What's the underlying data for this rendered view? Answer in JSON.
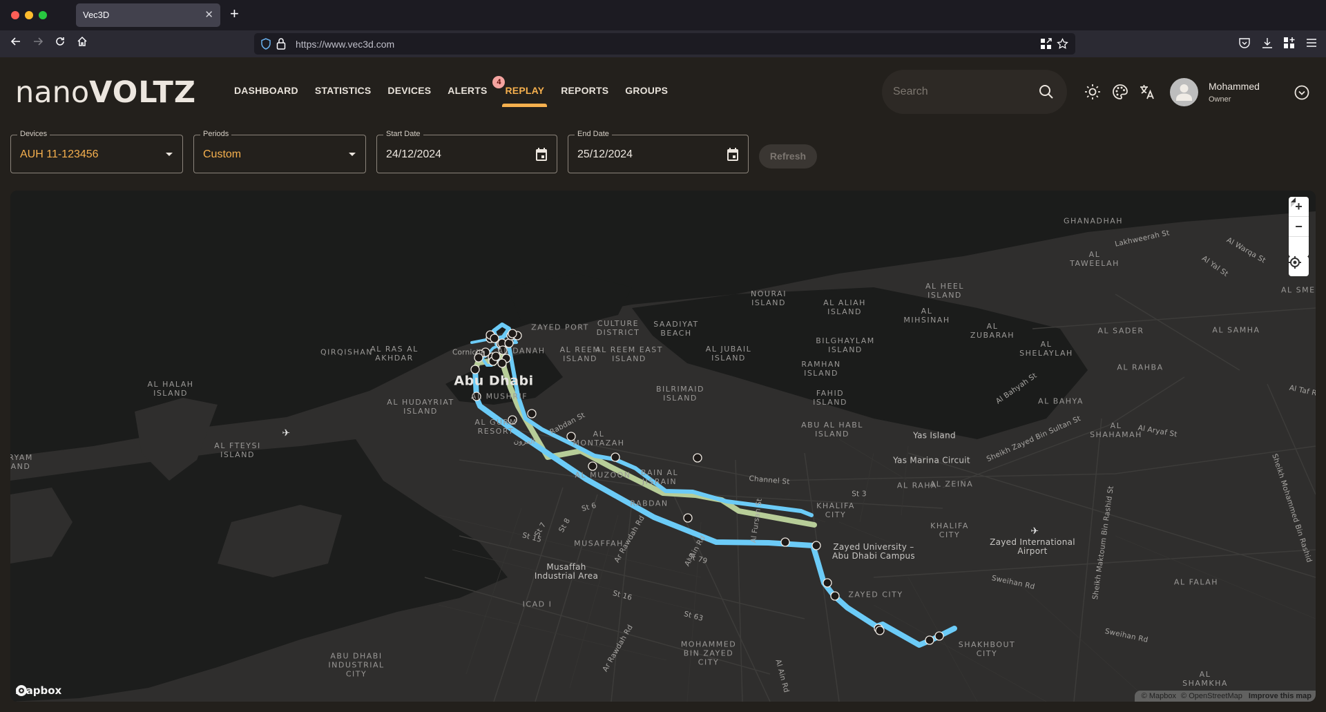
{
  "browser": {
    "tab_title": "Vec3D",
    "url": "https://www.vec3d.com"
  },
  "app": {
    "logo_prefix": "nano",
    "logo_suffix": "VOLTZ",
    "nav": [
      {
        "label": "DASHBOARD",
        "active": false
      },
      {
        "label": "STATISTICS",
        "active": false
      },
      {
        "label": "DEVICES",
        "active": false
      },
      {
        "label": "ALERTS",
        "active": false,
        "badge": "4"
      },
      {
        "label": "REPLAY",
        "active": true
      },
      {
        "label": "REPORTS",
        "active": false
      },
      {
        "label": "GROUPS",
        "active": false
      }
    ],
    "search_placeholder": "Search",
    "user": {
      "name": "Mohammed",
      "role": "Owner"
    },
    "accent_color": "#f6b04e"
  },
  "filters": {
    "device": {
      "label": "Devices",
      "value": "AUH 11-123456"
    },
    "period": {
      "label": "Periods",
      "value": "Custom"
    },
    "start_date": {
      "label": "Start Date",
      "value": "24/12/2024"
    },
    "end_date": {
      "label": "End Date",
      "value": "25/12/2024"
    },
    "refresh_label": "Refresh"
  },
  "map": {
    "route_color_primary": "#6ccbf7",
    "route_color_secondary": "#b7cd98",
    "attribution": {
      "mapbox": "© Mapbox",
      "osm": "© OpenStreetMap",
      "improve": "Improve this map"
    },
    "logo_text": "mapbox",
    "labels": [
      {
        "text": "Abu Dhabi",
        "kind": "city"
      },
      {
        "text": "ZAYED PORT",
        "kind": "area"
      },
      {
        "text": "CULTURE\nDISTRICT",
        "kind": "area"
      },
      {
        "text": "SAADIYAT\nBEACH",
        "kind": "area"
      },
      {
        "text": "AL RAS AL\nAKHDAR",
        "kind": "area"
      },
      {
        "text": "QIRQISHAN",
        "kind": "area"
      },
      {
        "text": "AL DANAH",
        "kind": "area"
      },
      {
        "text": "Corniche",
        "kind": "road"
      },
      {
        "text": "AL REEM\nISLAND",
        "kind": "area"
      },
      {
        "text": "AL REEM EAST\nISLAND",
        "kind": "area"
      },
      {
        "text": "AL JUBAIL\nISLAND",
        "kind": "area"
      },
      {
        "text": "AL MUSHRIF",
        "kind": "area"
      },
      {
        "text": "AL HUDAYRIAT\nISLAND",
        "kind": "area"
      },
      {
        "text": "AL HALAH\nISLAND",
        "kind": "area"
      },
      {
        "text": "AL FTEYSI\nISLAND",
        "kind": "area"
      },
      {
        "text": "RYAM\nAND",
        "kind": "area"
      },
      {
        "text": "AL GURM\nRESORT",
        "kind": "area"
      },
      {
        "text": "المرون",
        "kind": "road"
      },
      {
        "text": "Rabdan St",
        "kind": "road"
      },
      {
        "text": "AL\nMONTAZAH",
        "kind": "area"
      },
      {
        "text": "BILRIMAID\nISLAND",
        "kind": "area"
      },
      {
        "text": "NOURAI\nISLAND",
        "kind": "area"
      },
      {
        "text": "AL ALIAH\nISLAND",
        "kind": "area"
      },
      {
        "text": "AL HEEL\nISLAND",
        "kind": "area"
      },
      {
        "text": "AL\nMIHSINAH",
        "kind": "area"
      },
      {
        "text": "AL\nZUBARAH",
        "kind": "area"
      },
      {
        "text": "BILGHAYLAM\nISLAND",
        "kind": "area"
      },
      {
        "text": "RAMHAN\nISLAND",
        "kind": "area"
      },
      {
        "text": "FAHID\nISLAND",
        "kind": "area"
      },
      {
        "text": "ABU AL HABL\nISLAND",
        "kind": "area"
      },
      {
        "text": "AL\nSHELAYLAH",
        "kind": "area"
      },
      {
        "text": "GHANADHAH",
        "kind": "area"
      },
      {
        "text": "AL\nTAWEELAH",
        "kind": "area"
      },
      {
        "text": "Lakhweerah St",
        "kind": "road"
      },
      {
        "text": "Al Yal St",
        "kind": "road"
      },
      {
        "text": "Al Warqa St",
        "kind": "road"
      },
      {
        "text": "AL SMEIH",
        "kind": "area"
      },
      {
        "text": "AL SADER",
        "kind": "area"
      },
      {
        "text": "AL SAMHA",
        "kind": "area"
      },
      {
        "text": "AL RAHBA",
        "kind": "area"
      },
      {
        "text": "Al Bahyah St",
        "kind": "road"
      },
      {
        "text": "AL BAHYA",
        "kind": "area"
      },
      {
        "text": "Al Taf Rd",
        "kind": "road"
      },
      {
        "text": "Al Aryaf St",
        "kind": "road"
      },
      {
        "text": "AL\nSHAHAMAH",
        "kind": "area"
      },
      {
        "text": "Yas Island",
        "kind": "poi"
      },
      {
        "text": "Yas Marina Circuit",
        "kind": "poi"
      },
      {
        "text": "Sheikh Zayed Bin Sultan St",
        "kind": "road"
      },
      {
        "text": "AL RAHA",
        "kind": "area"
      },
      {
        "text": "AL ZEINA",
        "kind": "area"
      },
      {
        "text": "AL MUZOON",
        "kind": "area"
      },
      {
        "text": "BAIN AL\nJISRAIN",
        "kind": "area"
      },
      {
        "text": "Channel St",
        "kind": "road"
      },
      {
        "text": "St 3",
        "kind": "road"
      },
      {
        "text": "RABDAN",
        "kind": "area"
      },
      {
        "text": "KHALIFA\nCITY",
        "kind": "area"
      },
      {
        "text": "KHALIFA\nCITY",
        "kind": "area"
      },
      {
        "text": "Al Fursan St",
        "kind": "road"
      },
      {
        "text": "Zayed International\nAirport",
        "kind": "poi"
      },
      {
        "text": "Sheikh Maktoum Bin Rashid St",
        "kind": "road"
      },
      {
        "text": "Sheikh Mohammed Bin Rashid",
        "kind": "road"
      },
      {
        "text": "St 6",
        "kind": "road"
      },
      {
        "text": "St 7",
        "kind": "road"
      },
      {
        "text": "St 8",
        "kind": "road"
      },
      {
        "text": "St 15",
        "kind": "road"
      },
      {
        "text": "MUSAFFAH",
        "kind": "area"
      },
      {
        "text": "Ar Rawdah Rd",
        "kind": "road"
      },
      {
        "text": "Al Ain Rd",
        "kind": "road"
      },
      {
        "text": "St 79",
        "kind": "road"
      },
      {
        "text": "Zayed University –\nAbu Dhabi Campus",
        "kind": "poi"
      },
      {
        "text": "Sweihan Rd",
        "kind": "road"
      },
      {
        "text": "Musaffah\nIndustrial Area",
        "kind": "poi"
      },
      {
        "text": "ZAYED CITY",
        "kind": "area"
      },
      {
        "text": "AL FALAH",
        "kind": "area"
      },
      {
        "text": "ICAD I",
        "kind": "area"
      },
      {
        "text": "St 16",
        "kind": "road"
      },
      {
        "text": "St 63",
        "kind": "road"
      },
      {
        "text": "Ar Rawdah Rd",
        "kind": "road"
      },
      {
        "text": "SHAKHBOUT\nCITY",
        "kind": "area"
      },
      {
        "text": "Sweihan Rd",
        "kind": "road"
      },
      {
        "text": "MOHAMMED\nBIN ZAYED\nCITY",
        "kind": "area"
      },
      {
        "text": "Al Ain Rd",
        "kind": "road"
      },
      {
        "text": "ABU DHABI\nINDUSTRIAL\nCITY",
        "kind": "area"
      },
      {
        "text": "AL\nSHAMKHA",
        "kind": "area"
      }
    ]
  }
}
